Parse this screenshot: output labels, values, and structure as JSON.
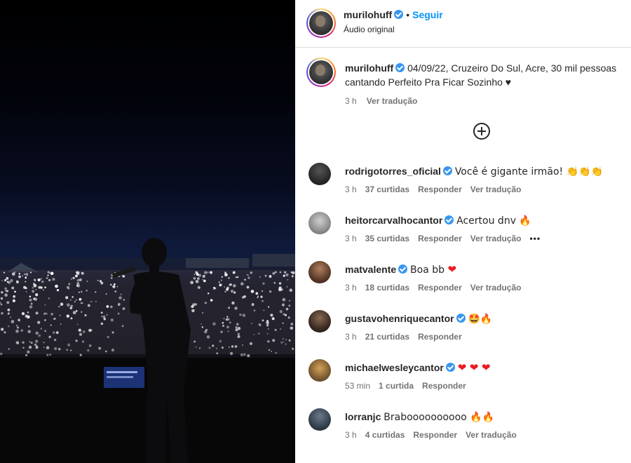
{
  "post": {
    "username": "murilohuff",
    "follow_label": "Seguir",
    "audio_label": "Áudio original",
    "separator": "•"
  },
  "caption": {
    "username": "murilohuff",
    "text": "04/09/22, Cruzeiro Do Sul, Acre, 30 mil pessoas cantando Perfeito Pra Ficar Sozinho ♥",
    "time": "3 h",
    "translate_label": "Ver tradução"
  },
  "actions": {
    "load_more_icon": "plus-circle-icon"
  },
  "comments": [
    {
      "username": "rodrigotorres_oficial",
      "verified": true,
      "text": "Você é gigante irmão! 👏👏👏",
      "time": "3 h",
      "likes": "37 curtidas",
      "reply": "Responder",
      "translate": "Ver tradução"
    },
    {
      "username": "heitorcarvalhocantor",
      "verified": true,
      "text": "Acertou dnv 🔥",
      "time": "3 h",
      "likes": "35 curtidas",
      "reply": "Responder",
      "translate": "Ver tradução",
      "more": "•••"
    },
    {
      "username": "matvalente",
      "verified": true,
      "text": "Boa bb ❤",
      "time": "3 h",
      "likes": "18 curtidas",
      "reply": "Responder",
      "translate": "Ver tradução"
    },
    {
      "username": "gustavohenriquecantor",
      "verified": true,
      "text": "🤩🔥",
      "time": "3 h",
      "likes": "21 curtidas",
      "reply": "Responder",
      "translate": ""
    },
    {
      "username": "michaelwesleycantor",
      "verified": true,
      "text": "❤ ❤ ❤",
      "time": "53 min",
      "likes": "1 curtida",
      "reply": "Responder",
      "translate": ""
    },
    {
      "username": "lorranjc",
      "verified": false,
      "text": "Braboooooooooo 🔥🔥",
      "time": "3 h",
      "likes": "4 curtidas",
      "reply": "Responder",
      "translate": "Ver tradução"
    }
  ],
  "colors": {
    "link_blue": "#0095f6",
    "verified_blue": "#3897f0",
    "muted_text": "#737373",
    "heart_red": "#ed1c24"
  }
}
